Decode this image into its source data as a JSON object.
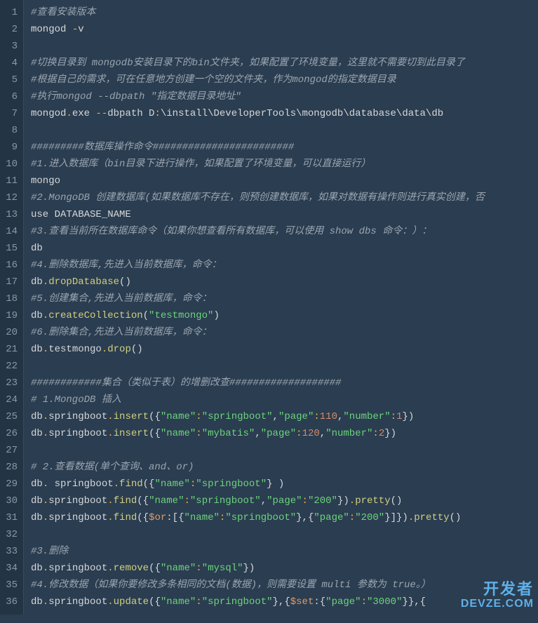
{
  "lines": [
    {
      "num": 1,
      "tokens": [
        {
          "t": "#查看安装版本",
          "cls": "c"
        }
      ]
    },
    {
      "num": 2,
      "tokens": [
        {
          "t": "mongod ",
          "cls": "p"
        },
        {
          "t": "-",
          "cls": "o"
        },
        {
          "t": "v",
          "cls": "p"
        }
      ]
    },
    {
      "num": 3,
      "tokens": []
    },
    {
      "num": 4,
      "tokens": [
        {
          "t": "#切换目录到 mongodb安装目录下的bin文件夹，如果配置了环境变量，这里就不需要切到此目录了",
          "cls": "c"
        }
      ]
    },
    {
      "num": 5,
      "tokens": [
        {
          "t": "#根据自己的需求，可在任意地方创建一个空的文件夹，作为mongod的指定数据目录",
          "cls": "c"
        }
      ]
    },
    {
      "num": 6,
      "tokens": [
        {
          "t": "#执行mongod --dbpath \"指定数据目录地址\"",
          "cls": "c"
        }
      ]
    },
    {
      "num": 7,
      "tokens": [
        {
          "t": "mongod",
          "cls": "p"
        },
        {
          "t": ".",
          "cls": "o"
        },
        {
          "t": "exe ",
          "cls": "p"
        },
        {
          "t": "--",
          "cls": "o"
        },
        {
          "t": "dbpath  D",
          "cls": "p"
        },
        {
          "t": ":",
          "cls": "o"
        },
        {
          "t": "\\install\\DeveloperTools\\mongodb\\database\\data\\db",
          "cls": "p"
        }
      ]
    },
    {
      "num": 8,
      "tokens": []
    },
    {
      "num": 9,
      "tokens": [
        {
          "t": "#########数据库操作命令########################",
          "cls": "c"
        }
      ]
    },
    {
      "num": 10,
      "tokens": [
        {
          "t": "#1.进入数据库（bin目录下进行操作，如果配置了环境变量，可以直接运行）",
          "cls": "c"
        }
      ]
    },
    {
      "num": 11,
      "tokens": [
        {
          "t": "mongo",
          "cls": "p"
        }
      ]
    },
    {
      "num": 12,
      "tokens": [
        {
          "t": "#2.MongoDB 创建数据库(如果数据库不存在，则预创建数据库，如果对数据有操作则进行真实创建，否",
          "cls": "c"
        }
      ]
    },
    {
      "num": 13,
      "tokens": [
        {
          "t": "use DATABASE_NAME",
          "cls": "p"
        }
      ]
    },
    {
      "num": 14,
      "tokens": [
        {
          "t": "#3.查看当前所在数据库命令（如果你想查看所有数据库，可以使用 show dbs 命令：）：",
          "cls": "c"
        }
      ]
    },
    {
      "num": 15,
      "tokens": [
        {
          "t": "db",
          "cls": "p"
        }
      ]
    },
    {
      "num": 16,
      "tokens": [
        {
          "t": "#4.删除数据库,先进入当前数据库，命令：",
          "cls": "c"
        }
      ]
    },
    {
      "num": 17,
      "tokens": [
        {
          "t": "db",
          "cls": "p"
        },
        {
          "t": ".",
          "cls": "o"
        },
        {
          "t": "dropDatabase",
          "cls": "m"
        },
        {
          "t": "()",
          "cls": "p"
        }
      ]
    },
    {
      "num": 18,
      "tokens": [
        {
          "t": "#5.创建集合,先进入当前数据库，命令：",
          "cls": "c"
        }
      ]
    },
    {
      "num": 19,
      "tokens": [
        {
          "t": "db",
          "cls": "p"
        },
        {
          "t": ".",
          "cls": "o"
        },
        {
          "t": "createCollection",
          "cls": "m"
        },
        {
          "t": "(",
          "cls": "p"
        },
        {
          "t": "\"testmongo\"",
          "cls": "s"
        },
        {
          "t": ")",
          "cls": "p"
        }
      ]
    },
    {
      "num": 20,
      "tokens": [
        {
          "t": "#6.删除集合,先进入当前数据库，命令：",
          "cls": "c"
        }
      ]
    },
    {
      "num": 21,
      "tokens": [
        {
          "t": "db",
          "cls": "p"
        },
        {
          "t": ".",
          "cls": "o"
        },
        {
          "t": "testmongo",
          "cls": "p"
        },
        {
          "t": ".",
          "cls": "o"
        },
        {
          "t": "drop",
          "cls": "m"
        },
        {
          "t": "()",
          "cls": "p"
        }
      ]
    },
    {
      "num": 22,
      "tokens": []
    },
    {
      "num": 23,
      "tokens": [
        {
          "t": "############集合（类似于表）的增删改查###################",
          "cls": "c"
        }
      ]
    },
    {
      "num": 24,
      "tokens": [
        {
          "t": "# 1.MongoDB 插入",
          "cls": "c"
        }
      ]
    },
    {
      "num": 25,
      "tokens": [
        {
          "t": "db",
          "cls": "p"
        },
        {
          "t": ".",
          "cls": "o"
        },
        {
          "t": "springboot",
          "cls": "p"
        },
        {
          "t": ".",
          "cls": "o"
        },
        {
          "t": "insert",
          "cls": "m"
        },
        {
          "t": "({",
          "cls": "p"
        },
        {
          "t": "\"name\"",
          "cls": "s"
        },
        {
          "t": ":",
          "cls": "o"
        },
        {
          "t": "\"springboot\"",
          "cls": "s"
        },
        {
          "t": ",",
          "cls": "p"
        },
        {
          "t": "\"page\"",
          "cls": "s"
        },
        {
          "t": ":",
          "cls": "o"
        },
        {
          "t": "110",
          "cls": "n"
        },
        {
          "t": ",",
          "cls": "p"
        },
        {
          "t": "\"number\"",
          "cls": "s"
        },
        {
          "t": ":",
          "cls": "o"
        },
        {
          "t": "1",
          "cls": "n"
        },
        {
          "t": "})",
          "cls": "p"
        }
      ]
    },
    {
      "num": 26,
      "tokens": [
        {
          "t": "db",
          "cls": "p"
        },
        {
          "t": ".",
          "cls": "o"
        },
        {
          "t": "springboot",
          "cls": "p"
        },
        {
          "t": ".",
          "cls": "o"
        },
        {
          "t": "insert",
          "cls": "m"
        },
        {
          "t": "({",
          "cls": "p"
        },
        {
          "t": "\"name\"",
          "cls": "s"
        },
        {
          "t": ":",
          "cls": "o"
        },
        {
          "t": "\"mybatis\"",
          "cls": "s"
        },
        {
          "t": ",",
          "cls": "p"
        },
        {
          "t": "\"page\"",
          "cls": "s"
        },
        {
          "t": ":",
          "cls": "o"
        },
        {
          "t": "120",
          "cls": "n"
        },
        {
          "t": ",",
          "cls": "p"
        },
        {
          "t": "\"number\"",
          "cls": "s"
        },
        {
          "t": ":",
          "cls": "o"
        },
        {
          "t": "2",
          "cls": "n"
        },
        {
          "t": "})",
          "cls": "p"
        }
      ]
    },
    {
      "num": 27,
      "tokens": []
    },
    {
      "num": 28,
      "tokens": [
        {
          "t": "# 2.查看数据(单个查询、and、or)",
          "cls": "c"
        }
      ]
    },
    {
      "num": 29,
      "tokens": [
        {
          "t": "db",
          "cls": "p"
        },
        {
          "t": ".",
          "cls": "o"
        },
        {
          "t": " springboot",
          "cls": "p"
        },
        {
          "t": ".",
          "cls": "o"
        },
        {
          "t": "find",
          "cls": "m"
        },
        {
          "t": "({",
          "cls": "p"
        },
        {
          "t": "\"name\"",
          "cls": "s"
        },
        {
          "t": ":",
          "cls": "o"
        },
        {
          "t": "\"springboot\"",
          "cls": "s"
        },
        {
          "t": "} )",
          "cls": "p"
        }
      ]
    },
    {
      "num": 30,
      "tokens": [
        {
          "t": "db",
          "cls": "p"
        },
        {
          "t": ".",
          "cls": "o"
        },
        {
          "t": "springboot",
          "cls": "p"
        },
        {
          "t": ".",
          "cls": "o"
        },
        {
          "t": "find",
          "cls": "m"
        },
        {
          "t": "({",
          "cls": "p"
        },
        {
          "t": "\"name\"",
          "cls": "s"
        },
        {
          "t": ":",
          "cls": "o"
        },
        {
          "t": "\"springboot\"",
          "cls": "s"
        },
        {
          "t": ",",
          "cls": "p"
        },
        {
          "t": "\"page\"",
          "cls": "s"
        },
        {
          "t": ":",
          "cls": "o"
        },
        {
          "t": "\"200\"",
          "cls": "s"
        },
        {
          "t": "})",
          "cls": "p"
        },
        {
          "t": ".",
          "cls": "o"
        },
        {
          "t": "pretty",
          "cls": "m"
        },
        {
          "t": "()",
          "cls": "p"
        }
      ]
    },
    {
      "num": 31,
      "tokens": [
        {
          "t": "db",
          "cls": "p"
        },
        {
          "t": ".",
          "cls": "o"
        },
        {
          "t": "springboot",
          "cls": "p"
        },
        {
          "t": ".",
          "cls": "o"
        },
        {
          "t": "find",
          "cls": "m"
        },
        {
          "t": "({",
          "cls": "p"
        },
        {
          "t": "$or",
          "cls": "dl"
        },
        {
          "t": ":[{",
          "cls": "p"
        },
        {
          "t": "\"name\"",
          "cls": "s"
        },
        {
          "t": ":",
          "cls": "o"
        },
        {
          "t": "\"springboot\"",
          "cls": "s"
        },
        {
          "t": "},{",
          "cls": "p"
        },
        {
          "t": "\"page\"",
          "cls": "s"
        },
        {
          "t": ":",
          "cls": "o"
        },
        {
          "t": "\"200\"",
          "cls": "s"
        },
        {
          "t": "}]})",
          "cls": "p"
        },
        {
          "t": ".",
          "cls": "o"
        },
        {
          "t": "pretty",
          "cls": "m"
        },
        {
          "t": "()",
          "cls": "p"
        }
      ]
    },
    {
      "num": 32,
      "tokens": []
    },
    {
      "num": 33,
      "tokens": [
        {
          "t": "#3.删除",
          "cls": "c"
        }
      ]
    },
    {
      "num": 34,
      "tokens": [
        {
          "t": "db",
          "cls": "p"
        },
        {
          "t": ".",
          "cls": "o"
        },
        {
          "t": "springboot",
          "cls": "p"
        },
        {
          "t": ".",
          "cls": "o"
        },
        {
          "t": "remove",
          "cls": "m"
        },
        {
          "t": "({",
          "cls": "p"
        },
        {
          "t": "\"name\"",
          "cls": "s"
        },
        {
          "t": ":",
          "cls": "o"
        },
        {
          "t": "\"mysql\"",
          "cls": "s"
        },
        {
          "t": "})",
          "cls": "p"
        }
      ]
    },
    {
      "num": 35,
      "tokens": [
        {
          "t": "#4.修改数据（如果你要修改多条相同的文档(数据)，则需要设置 multi 参数为 true。）",
          "cls": "c"
        }
      ]
    },
    {
      "num": 36,
      "tokens": [
        {
          "t": "db",
          "cls": "p"
        },
        {
          "t": ".",
          "cls": "o"
        },
        {
          "t": "springboot",
          "cls": "p"
        },
        {
          "t": ".",
          "cls": "o"
        },
        {
          "t": "update",
          "cls": "m"
        },
        {
          "t": "({",
          "cls": "p"
        },
        {
          "t": "\"name\"",
          "cls": "s"
        },
        {
          "t": ":",
          "cls": "o"
        },
        {
          "t": "\"springboot\"",
          "cls": "s"
        },
        {
          "t": "},{",
          "cls": "p"
        },
        {
          "t": "$set",
          "cls": "dl"
        },
        {
          "t": ":{",
          "cls": "p"
        },
        {
          "t": "\"page\"",
          "cls": "s"
        },
        {
          "t": ":",
          "cls": "o"
        },
        {
          "t": "\"3000\"",
          "cls": "s"
        },
        {
          "t": "}},{",
          "cls": "p"
        }
      ]
    }
  ],
  "watermark": {
    "zh": "开发者",
    "en": "DEVZE.COM"
  }
}
